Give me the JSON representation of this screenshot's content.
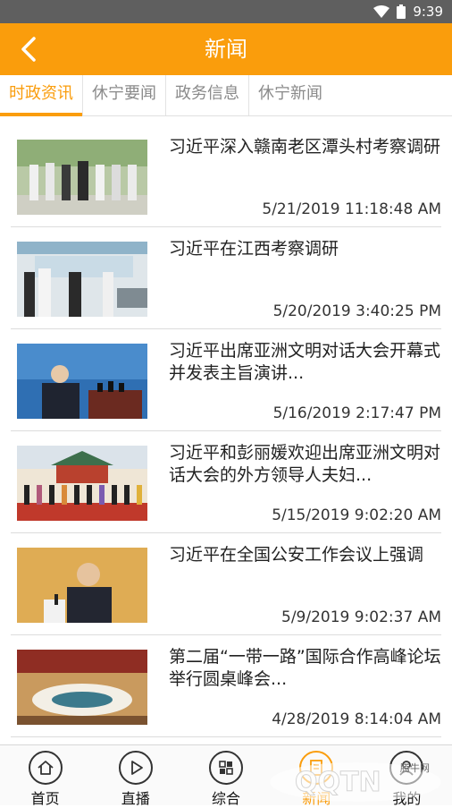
{
  "status": {
    "time": "9:39"
  },
  "header": {
    "title": "新闻"
  },
  "tabs": [
    {
      "label": "时政资讯",
      "active": true
    },
    {
      "label": "休宁要闻",
      "active": false
    },
    {
      "label": "政务信息",
      "active": false
    },
    {
      "label": "休宁新闻",
      "active": false
    }
  ],
  "news": [
    {
      "title": "习近平深入赣南老区潭头村考察调研",
      "date": "5/21/2019 11:18:48 AM"
    },
    {
      "title": "习近平在江西考察调研",
      "date": "5/20/2019 3:40:25 PM"
    },
    {
      "title": "习近平出席亚洲文明对话大会开幕式并发表主旨演讲...",
      "date": "5/16/2019 2:17:47 PM"
    },
    {
      "title": "习近平和彭丽媛欢迎出席亚洲文明对话大会的外方领导人夫妇...",
      "date": "5/15/2019 9:02:20 AM"
    },
    {
      "title": "习近平在全国公安工作会议上强调",
      "date": "5/9/2019 9:02:37 AM"
    },
    {
      "title": "第二届“一带一路”国际合作高峰论坛举行圆桌峰会...",
      "date": "4/28/2019 8:14:04 AM"
    }
  ],
  "bottom_nav": [
    {
      "label": "首页",
      "icon": "home-icon"
    },
    {
      "label": "直播",
      "icon": "play-icon"
    },
    {
      "label": "综合",
      "icon": "grid-icon"
    },
    {
      "label": "新闻",
      "icon": "document-icon",
      "active": true
    },
    {
      "label": "我的",
      "icon": "user-icon"
    }
  ],
  "watermark": {
    "text": "QQTN",
    "sub": "腾牛网"
  },
  "colors": {
    "accent": "#fa9d0c",
    "status_bar": "#5f5f5f"
  }
}
